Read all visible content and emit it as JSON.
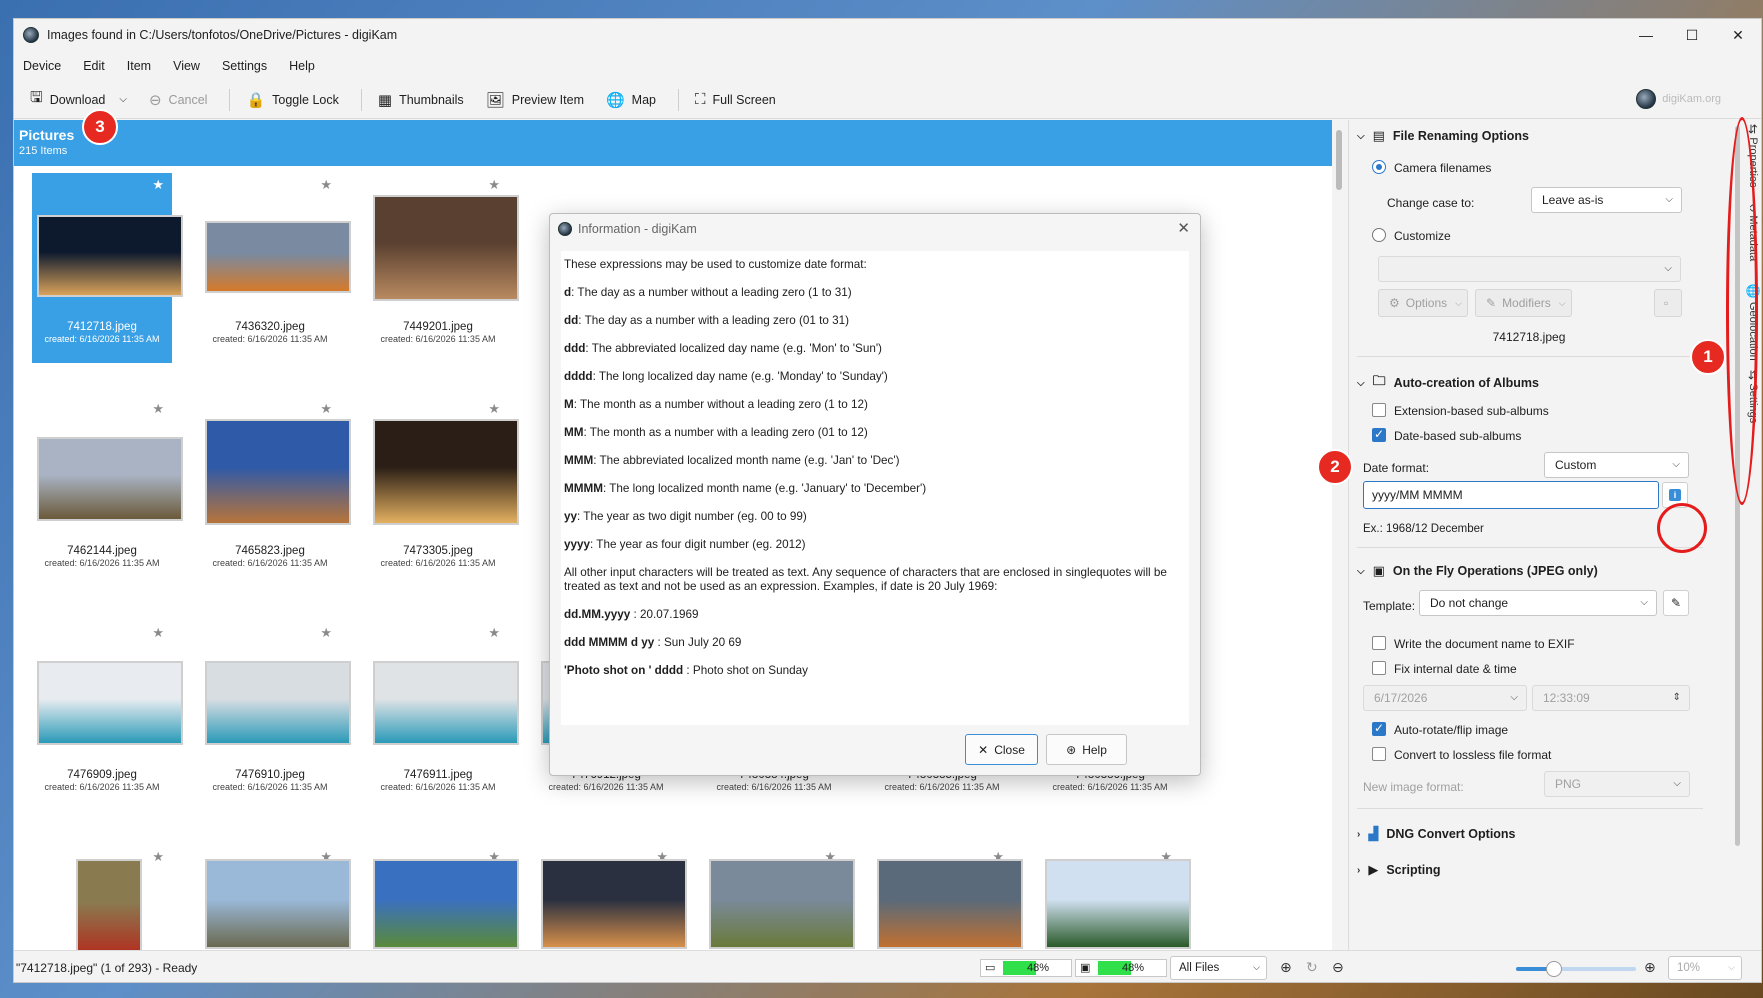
{
  "window": {
    "title": "Images found in C:/Users/tonfotos/OneDrive/Pictures - digiKam",
    "controls": [
      "—",
      "☐",
      "✕"
    ]
  },
  "menu": [
    "Device",
    "Edit",
    "Item",
    "View",
    "Settings",
    "Help"
  ],
  "toolbar": {
    "download": "Download",
    "cancel": "Cancel",
    "toggle_lock": "Toggle Lock",
    "thumbnails": "Thumbnails",
    "preview_item": "Preview Item",
    "map": "Map",
    "full_screen": "Full Screen",
    "brand": "digiKam.org"
  },
  "album": {
    "title": "Pictures",
    "count": "215 Items"
  },
  "thumbnails": [
    {
      "name": "7412718.jpeg",
      "date": "created: 6/16/2026 11:35 AM",
      "selected": true,
      "colors": [
        "#0d1a2e",
        "#d9a25a"
      ]
    },
    {
      "name": "7436320.jpeg",
      "date": "created: 6/16/2026 11:35 AM",
      "colors": [
        "#7a8aa0",
        "#d57a2a"
      ]
    },
    {
      "name": "7449201.jpeg",
      "date": "created: 6/16/2026 11:35 AM",
      "colors": [
        "#5a4030",
        "#b88a60"
      ]
    },
    {
      "name": "7462144.jpeg",
      "date": "created: 6/16/2026 11:35 AM",
      "colors": [
        "#a9b3c4",
        "#6b5a3a"
      ]
    },
    {
      "name": "7465823.jpeg",
      "date": "created: 6/16/2026 11:35 AM",
      "colors": [
        "#2f5aa8",
        "#b8743a"
      ]
    },
    {
      "name": "7473305.jpeg",
      "date": "created: 6/16/2026 11:35 AM",
      "colors": [
        "#2a1e16",
        "#e3b060"
      ]
    },
    {
      "name": "7476909.jpeg",
      "date": "created: 6/16/2026 11:35 AM",
      "colors": [
        "#e8ecf0",
        "#2a9ab8"
      ]
    },
    {
      "name": "7476910.jpeg",
      "date": "created: 6/16/2026 11:35 AM",
      "colors": [
        "#d8dde2",
        "#2a9ab8"
      ]
    },
    {
      "name": "7476911.jpeg",
      "date": "created: 6/16/2026 11:35 AM",
      "colors": [
        "#dfe3e6",
        "#2a9ab8"
      ]
    },
    {
      "name": "7476912.jpeg",
      "date": "created: 6/16/2026 11:35 AM",
      "colors": [
        "#dfe3e6",
        "#2a9ab8"
      ]
    },
    {
      "name": "7480384.jpeg",
      "date": "created: 6/16/2026 11:35 AM",
      "colors": [
        "#3b3b3b",
        "#8a8a70"
      ]
    },
    {
      "name": "7480385.jpeg",
      "date": "created: 6/16/2026 11:35 AM",
      "colors": [
        "#3b3b3b",
        "#8a7a60"
      ]
    },
    {
      "name": "7480386.jpeg",
      "date": "created: 6/16/2026 11:35 AM",
      "colors": [
        "#4a4a3a",
        "#7a8a60"
      ]
    },
    {
      "name": "",
      "date": "",
      "colors": [
        "#8a7a50",
        "#b03020"
      ]
    },
    {
      "name": "",
      "date": "",
      "colors": [
        "#9ab8d8",
        "#6a6a50"
      ]
    },
    {
      "name": "",
      "date": "",
      "colors": [
        "#3a70c0",
        "#5a8a3a"
      ]
    },
    {
      "name": "",
      "date": "",
      "colors": [
        "#2a3040",
        "#d8904a"
      ]
    },
    {
      "name": "",
      "date": "",
      "colors": [
        "#7a8a9a",
        "#6a7a3a"
      ]
    },
    {
      "name": "",
      "date": "",
      "colors": [
        "#5a6a7a",
        "#c07030"
      ]
    },
    {
      "name": "",
      "date": "",
      "colors": [
        "#d0e0f0",
        "#2a5a2a"
      ]
    }
  ],
  "dialog": {
    "title": "Information - digiKam",
    "intro": "These expressions may be used to customize date format:",
    "entries": [
      {
        "k": "d",
        "v": ": The day as a number without a leading zero (1 to 31)"
      },
      {
        "k": "dd",
        "v": ": The day as a number with a leading zero (01 to 31)"
      },
      {
        "k": "ddd",
        "v": ": The abbreviated localized day name (e.g. 'Mon' to 'Sun')"
      },
      {
        "k": "dddd",
        "v": ": The long localized day name (e.g. 'Monday' to 'Sunday')"
      },
      {
        "k": "M",
        "v": ": The month as a number without a leading zero (1 to 12)"
      },
      {
        "k": "MM",
        "v": ": The month as a number with a leading zero (01 to 12)"
      },
      {
        "k": "MMM",
        "v": ": The abbreviated localized month name (e.g. 'Jan' to 'Dec')"
      },
      {
        "k": "MMMM",
        "v": ": The long localized month name (e.g. 'January' to 'December')"
      },
      {
        "k": "yy",
        "v": ": The year as two digit number (eg. 00 to 99)"
      },
      {
        "k": "yyyy",
        "v": ": The year as four digit number (eg. 2012)"
      }
    ],
    "note": "All other input characters will be treated as text. Any sequence of characters that are enclosed in singlequotes will be treated as text and not be used as an expression. Examples, if date is 20 July 1969:",
    "examples": [
      {
        "k": "dd.MM.yyyy",
        "v": " : 20.07.1969"
      },
      {
        "k": "ddd MMMM d yy",
        "v": " : Sun July 20 69"
      },
      {
        "k": "'Photo shot on ' dddd",
        "v": " : Photo shot on Sunday"
      }
    ],
    "close": "Close",
    "help": "Help"
  },
  "panel": {
    "renaming": {
      "title": "File Renaming Options",
      "camera_filenames": "Camera filenames",
      "change_case_label": "Change case to:",
      "change_case_value": "Leave as-is",
      "customize": "Customize",
      "options": "Options",
      "modifiers": "Modifiers",
      "preview": "7412718.jpeg"
    },
    "albums": {
      "title": "Auto-creation of Albums",
      "ext_sub": "Extension-based sub-albums",
      "date_sub": "Date-based sub-albums",
      "date_format_label": "Date format:",
      "date_format_value": "Custom",
      "custom_value": "yyyy/MM MMMM",
      "example": "Ex.: 1968/12 December"
    },
    "onthefly": {
      "title": "On the Fly Operations (JPEG only)",
      "template_label": "Template:",
      "template_value": "Do not change",
      "write_doc": "Write the document name to EXIF",
      "fix_date": "Fix internal date & time",
      "date_value": "6/17/2026",
      "time_value": "12:33:09",
      "autorotate": "Auto-rotate/flip image",
      "lossless": "Convert to lossless file format",
      "new_format_label": "New image format:",
      "new_format_value": "PNG"
    },
    "dng": {
      "title": "DNG Convert Options"
    },
    "scripting": {
      "title": "Scripting"
    }
  },
  "sidetabs": [
    "Properties",
    "Metadata",
    "Geolocation",
    "Settings"
  ],
  "status": {
    "text": "\"7412718.jpeg\" (1 of 293) - Ready",
    "progress1": 48,
    "progress1_label": "48%",
    "progress2": 48,
    "progress2_label": "48%",
    "filter": "All Files",
    "zoom": "10%"
  },
  "annotations": {
    "b1": "1",
    "b2": "2",
    "b3": "3",
    "color": "#e41c1c"
  }
}
